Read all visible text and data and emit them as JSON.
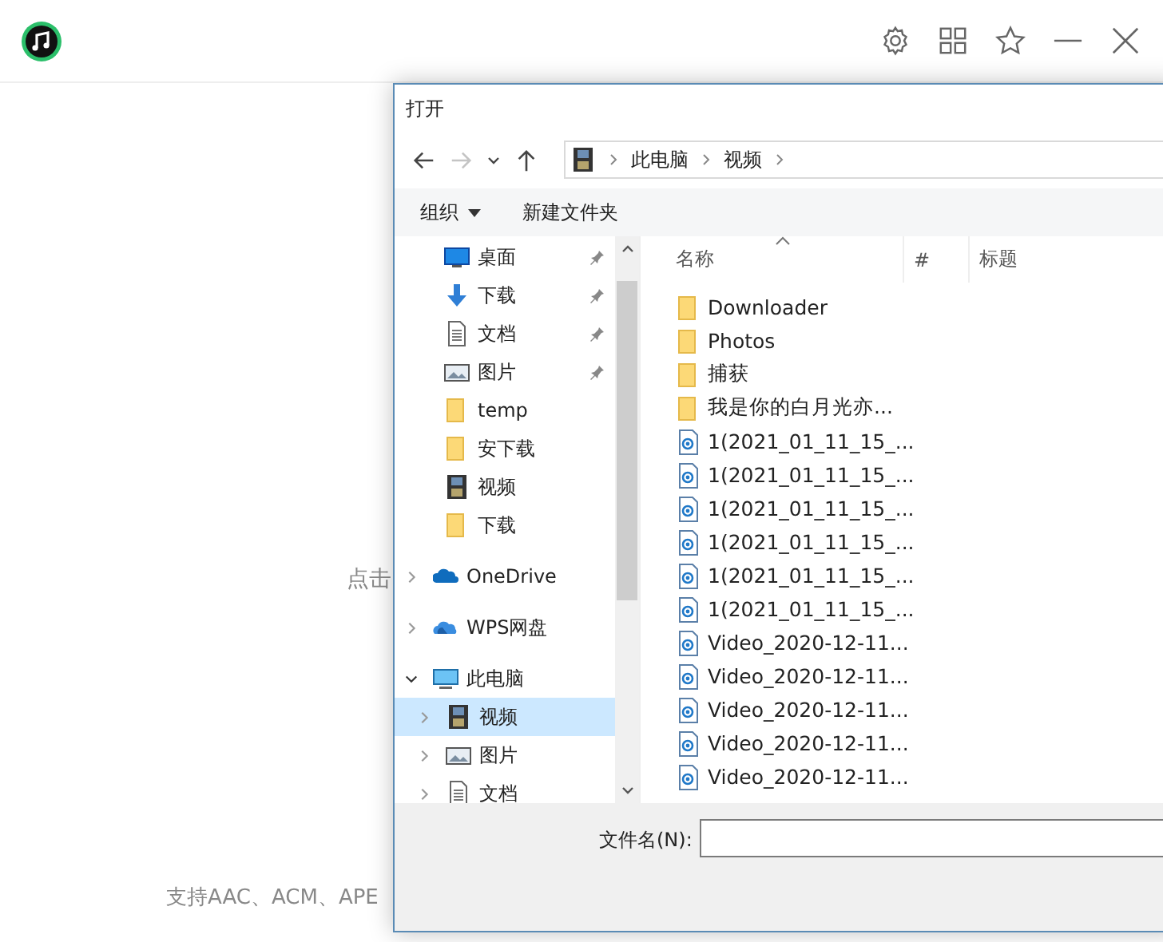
{
  "app": {
    "hint": "点击",
    "formats": "支持AAC、ACM、APE"
  },
  "dialog": {
    "title": "打开",
    "nav_buttons": [
      {
        "kind": "back",
        "disabled": false
      },
      {
        "kind": "forward",
        "disabled": true
      },
      {
        "kind": "recent",
        "disabled": false
      },
      {
        "kind": "up",
        "disabled": false
      }
    ],
    "breadcrumb": [
      "此电脑",
      "视频"
    ],
    "commands": [
      {
        "label": "组织",
        "dropdown": true
      },
      {
        "label": "新建文件夹",
        "dropdown": false
      }
    ],
    "quick_access": [
      {
        "label": "桌面",
        "kind": "desktop",
        "pinned": true
      },
      {
        "label": "下载",
        "kind": "download",
        "pinned": true
      },
      {
        "label": "文档",
        "kind": "document",
        "pinned": true
      },
      {
        "label": "图片",
        "kind": "picture",
        "pinned": true
      },
      {
        "label": "temp",
        "kind": "folder",
        "pinned": false
      },
      {
        "label": "安下载",
        "kind": "folder",
        "pinned": false
      },
      {
        "label": "视频",
        "kind": "video",
        "pinned": false
      },
      {
        "label": "下载",
        "kind": "folder",
        "pinned": false
      }
    ],
    "tree": [
      {
        "label": "OneDrive",
        "kind": "cloud",
        "expanded": false,
        "selected": false
      },
      {
        "label": "WPS网盘",
        "kind": "wps",
        "expanded": false,
        "selected": false
      },
      {
        "label": "此电脑",
        "kind": "computer",
        "expanded": true,
        "selected": false,
        "children": [
          {
            "label": "视频",
            "kind": "video",
            "expanded": false,
            "selected": true
          },
          {
            "label": "图片",
            "kind": "picture",
            "expanded": false,
            "selected": false
          },
          {
            "label": "文档",
            "kind": "document",
            "expanded": false,
            "selected": false
          }
        ]
      }
    ],
    "columns": [
      "名称",
      "#",
      "标题"
    ],
    "files": [
      {
        "name": "Downloader",
        "kind": "folder"
      },
      {
        "name": "Photos",
        "kind": "folder"
      },
      {
        "name": "捕获",
        "kind": "folder"
      },
      {
        "name": "我是你的白月光亦...",
        "kind": "folder"
      },
      {
        "name": "1(2021_01_11_15_...",
        "kind": "video"
      },
      {
        "name": "1(2021_01_11_15_...",
        "kind": "video"
      },
      {
        "name": "1(2021_01_11_15_...",
        "kind": "video"
      },
      {
        "name": "1(2021_01_11_15_...",
        "kind": "video"
      },
      {
        "name": "1(2021_01_11_15_...",
        "kind": "video"
      },
      {
        "name": "1(2021_01_11_15_...",
        "kind": "video"
      },
      {
        "name": "Video_2020-12-11...",
        "kind": "video"
      },
      {
        "name": "Video_2020-12-11...",
        "kind": "video"
      },
      {
        "name": "Video_2020-12-11...",
        "kind": "video"
      },
      {
        "name": "Video_2020-12-11...",
        "kind": "video"
      },
      {
        "name": "Video_2020-12-11...",
        "kind": "video"
      }
    ],
    "filename_label": "文件名(N):"
  }
}
